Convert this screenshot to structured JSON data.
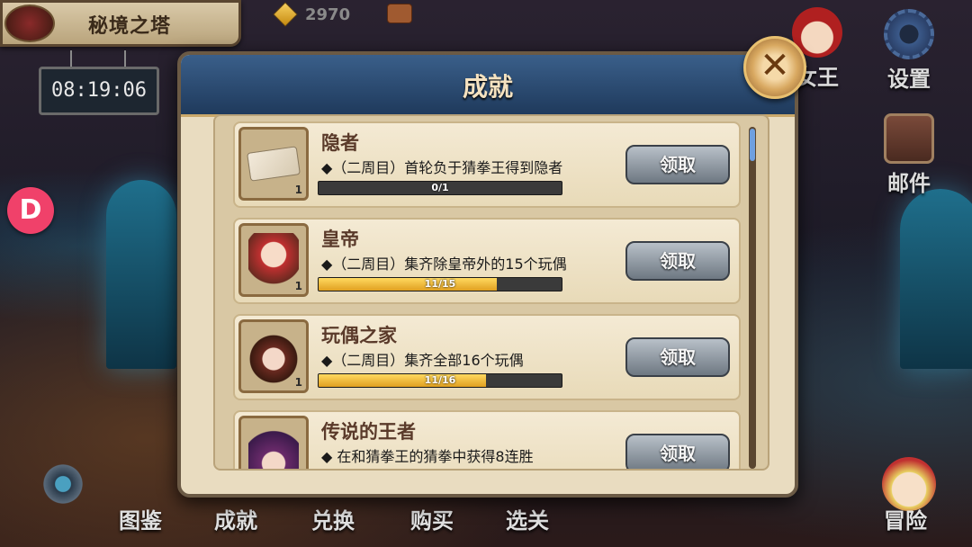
{
  "header": {
    "location_name": "秘境之塔",
    "timer": "08:19:06",
    "currency": {
      "icon": "gem-icon",
      "value": "2970"
    }
  },
  "side_menu": {
    "queen_label": "女王",
    "settings_label": "设置",
    "mail_label": "邮件",
    "badge_letter": "D"
  },
  "bottom_nav": {
    "items": [
      "图鉴",
      "成就",
      "兑换",
      "购买",
      "选关"
    ],
    "adventure_label": "冒险"
  },
  "modal": {
    "title": "成就",
    "close_symbol": "✕",
    "achievements": [
      {
        "title": "隐者",
        "description": "◆（二周目）首轮负于猜拳王得到隐者",
        "progress_label": "0/1",
        "progress": 0,
        "reward_count": "1",
        "button": "领取",
        "icon": "ticket-icon"
      },
      {
        "title": "皇帝",
        "description": "◆（二周目）集齐除皇帝外的15个玩偶",
        "progress_label": "11/15",
        "progress": 0.733,
        "reward_count": "1",
        "button": "领取",
        "icon": "emperor-doll-icon"
      },
      {
        "title": "玩偶之家",
        "description": "◆（二周目）集齐全部16个玩偶",
        "progress_label": "11/16",
        "progress": 0.6875,
        "reward_count": "1",
        "button": "领取",
        "icon": "doll-girl-icon"
      },
      {
        "title": "传说的王者",
        "description": "◆ 在和猜拳王的猜拳中获得8连胜",
        "progress_label": "",
        "progress": 0,
        "reward_count": "",
        "button": "领取",
        "icon": "purple-hair-icon"
      }
    ]
  }
}
